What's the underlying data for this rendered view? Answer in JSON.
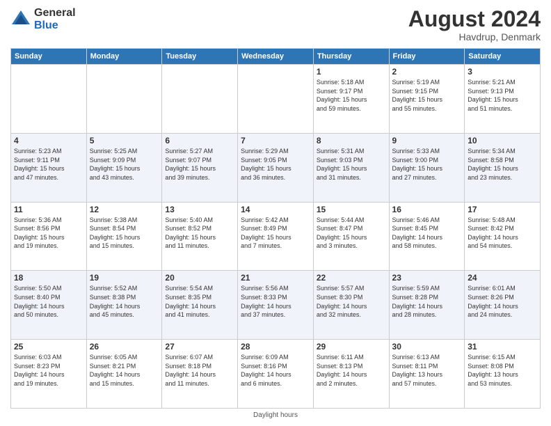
{
  "logo": {
    "general": "General",
    "blue": "Blue"
  },
  "title": "August 2024",
  "location": "Havdrup, Denmark",
  "footer": "Daylight hours",
  "headers": [
    "Sunday",
    "Monday",
    "Tuesday",
    "Wednesday",
    "Thursday",
    "Friday",
    "Saturday"
  ],
  "weeks": [
    [
      {
        "day": "",
        "info": ""
      },
      {
        "day": "",
        "info": ""
      },
      {
        "day": "",
        "info": ""
      },
      {
        "day": "",
        "info": ""
      },
      {
        "day": "1",
        "info": "Sunrise: 5:18 AM\nSunset: 9:17 PM\nDaylight: 15 hours\nand 59 minutes."
      },
      {
        "day": "2",
        "info": "Sunrise: 5:19 AM\nSunset: 9:15 PM\nDaylight: 15 hours\nand 55 minutes."
      },
      {
        "day": "3",
        "info": "Sunrise: 5:21 AM\nSunset: 9:13 PM\nDaylight: 15 hours\nand 51 minutes."
      }
    ],
    [
      {
        "day": "4",
        "info": "Sunrise: 5:23 AM\nSunset: 9:11 PM\nDaylight: 15 hours\nand 47 minutes."
      },
      {
        "day": "5",
        "info": "Sunrise: 5:25 AM\nSunset: 9:09 PM\nDaylight: 15 hours\nand 43 minutes."
      },
      {
        "day": "6",
        "info": "Sunrise: 5:27 AM\nSunset: 9:07 PM\nDaylight: 15 hours\nand 39 minutes."
      },
      {
        "day": "7",
        "info": "Sunrise: 5:29 AM\nSunset: 9:05 PM\nDaylight: 15 hours\nand 36 minutes."
      },
      {
        "day": "8",
        "info": "Sunrise: 5:31 AM\nSunset: 9:03 PM\nDaylight: 15 hours\nand 31 minutes."
      },
      {
        "day": "9",
        "info": "Sunrise: 5:33 AM\nSunset: 9:00 PM\nDaylight: 15 hours\nand 27 minutes."
      },
      {
        "day": "10",
        "info": "Sunrise: 5:34 AM\nSunset: 8:58 PM\nDaylight: 15 hours\nand 23 minutes."
      }
    ],
    [
      {
        "day": "11",
        "info": "Sunrise: 5:36 AM\nSunset: 8:56 PM\nDaylight: 15 hours\nand 19 minutes."
      },
      {
        "day": "12",
        "info": "Sunrise: 5:38 AM\nSunset: 8:54 PM\nDaylight: 15 hours\nand 15 minutes."
      },
      {
        "day": "13",
        "info": "Sunrise: 5:40 AM\nSunset: 8:52 PM\nDaylight: 15 hours\nand 11 minutes."
      },
      {
        "day": "14",
        "info": "Sunrise: 5:42 AM\nSunset: 8:49 PM\nDaylight: 15 hours\nand 7 minutes."
      },
      {
        "day": "15",
        "info": "Sunrise: 5:44 AM\nSunset: 8:47 PM\nDaylight: 15 hours\nand 3 minutes."
      },
      {
        "day": "16",
        "info": "Sunrise: 5:46 AM\nSunset: 8:45 PM\nDaylight: 14 hours\nand 58 minutes."
      },
      {
        "day": "17",
        "info": "Sunrise: 5:48 AM\nSunset: 8:42 PM\nDaylight: 14 hours\nand 54 minutes."
      }
    ],
    [
      {
        "day": "18",
        "info": "Sunrise: 5:50 AM\nSunset: 8:40 PM\nDaylight: 14 hours\nand 50 minutes."
      },
      {
        "day": "19",
        "info": "Sunrise: 5:52 AM\nSunset: 8:38 PM\nDaylight: 14 hours\nand 45 minutes."
      },
      {
        "day": "20",
        "info": "Sunrise: 5:54 AM\nSunset: 8:35 PM\nDaylight: 14 hours\nand 41 minutes."
      },
      {
        "day": "21",
        "info": "Sunrise: 5:56 AM\nSunset: 8:33 PM\nDaylight: 14 hours\nand 37 minutes."
      },
      {
        "day": "22",
        "info": "Sunrise: 5:57 AM\nSunset: 8:30 PM\nDaylight: 14 hours\nand 32 minutes."
      },
      {
        "day": "23",
        "info": "Sunrise: 5:59 AM\nSunset: 8:28 PM\nDaylight: 14 hours\nand 28 minutes."
      },
      {
        "day": "24",
        "info": "Sunrise: 6:01 AM\nSunset: 8:26 PM\nDaylight: 14 hours\nand 24 minutes."
      }
    ],
    [
      {
        "day": "25",
        "info": "Sunrise: 6:03 AM\nSunset: 8:23 PM\nDaylight: 14 hours\nand 19 minutes."
      },
      {
        "day": "26",
        "info": "Sunrise: 6:05 AM\nSunset: 8:21 PM\nDaylight: 14 hours\nand 15 minutes."
      },
      {
        "day": "27",
        "info": "Sunrise: 6:07 AM\nSunset: 8:18 PM\nDaylight: 14 hours\nand 11 minutes."
      },
      {
        "day": "28",
        "info": "Sunrise: 6:09 AM\nSunset: 8:16 PM\nDaylight: 14 hours\nand 6 minutes."
      },
      {
        "day": "29",
        "info": "Sunrise: 6:11 AM\nSunset: 8:13 PM\nDaylight: 14 hours\nand 2 minutes."
      },
      {
        "day": "30",
        "info": "Sunrise: 6:13 AM\nSunset: 8:11 PM\nDaylight: 13 hours\nand 57 minutes."
      },
      {
        "day": "31",
        "info": "Sunrise: 6:15 AM\nSunset: 8:08 PM\nDaylight: 13 hours\nand 53 minutes."
      }
    ]
  ]
}
